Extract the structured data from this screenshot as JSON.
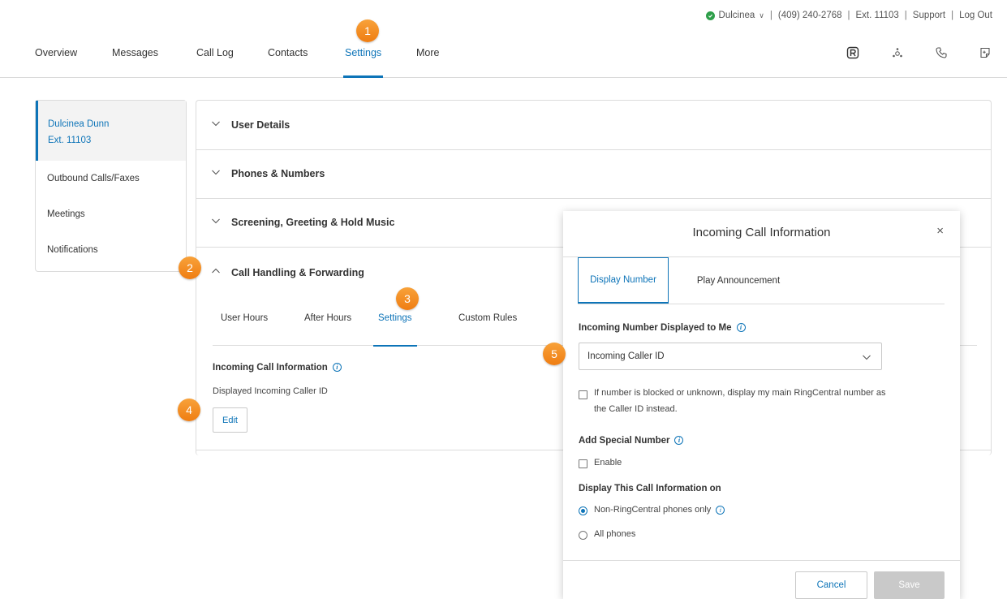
{
  "utility_bar": {
    "user_name": "Dulcinea",
    "phone": "(409) 240-2768",
    "extension": "Ext. 11103",
    "support": "Support",
    "logout": "Log Out",
    "status_color": "#2e9f4a"
  },
  "nav": {
    "items": [
      "Overview",
      "Messages",
      "Call Log",
      "Contacts",
      "Settings",
      "More"
    ],
    "active": "Settings",
    "icons": [
      "ringcentral-app-icon",
      "integrations-icon",
      "phone-icon",
      "notepad-icon"
    ]
  },
  "annotations": [
    "1",
    "2",
    "3",
    "4",
    "5"
  ],
  "sidebar": {
    "user_name": "Dulcinea Dunn",
    "user_ext": "Ext. 11103",
    "items": [
      "Outbound Calls/Faxes",
      "Meetings",
      "Notifications"
    ]
  },
  "sections": [
    {
      "title": "User Details",
      "expanded": false
    },
    {
      "title": "Phones & Numbers",
      "expanded": false
    },
    {
      "title": "Screening, Greeting & Hold Music",
      "expanded": false
    },
    {
      "title": "Call Handling & Forwarding",
      "expanded": true
    }
  ],
  "call_handling": {
    "tabs": [
      "User Hours",
      "After Hours",
      "Settings",
      "Custom Rules"
    ],
    "active_tab": "Settings",
    "incoming_label": "Incoming Call Information",
    "incoming_value": "Displayed Incoming Caller ID",
    "edit_label": "Edit"
  },
  "modal": {
    "title": "Incoming Call Information",
    "close": "×",
    "tabs": [
      "Display Number",
      "Play Announcement"
    ],
    "active_tab": "Display Number",
    "number_label": "Incoming Number Displayed to Me",
    "number_selected": "Incoming Caller ID",
    "blocked_text_1": "If number is blocked or unknown, display my main RingCentral number as",
    "blocked_text_2": "the Caller ID instead.",
    "blocked_checked": false,
    "special_label": "Add Special Number",
    "enable_label": "Enable",
    "enable_checked": false,
    "display_on_label": "Display This Call Information on",
    "display_options": [
      "Non-RingCentral phones only",
      "All phones"
    ],
    "display_selected": "Non-RingCentral phones only",
    "cancel": "Cancel",
    "save": "Save"
  },
  "colors": {
    "accent": "#0d74b8",
    "badge": "#f08a1e",
    "disabled_button": "#c9c9c9"
  }
}
